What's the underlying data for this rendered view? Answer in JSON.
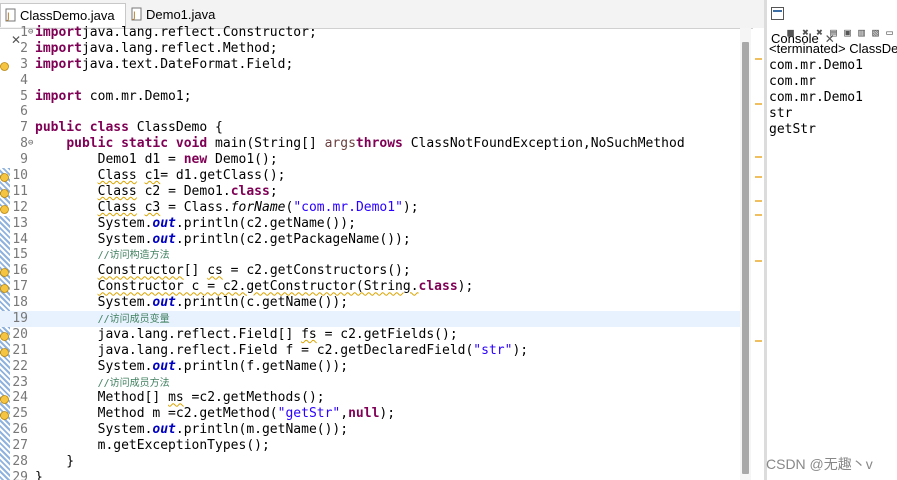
{
  "tabs": [
    {
      "label": "ClassDemo.java",
      "close": "✕",
      "active": true,
      "icon": "java-file-icon"
    },
    {
      "label": "Demo1.java",
      "active": false,
      "icon": "java-file-icon"
    }
  ],
  "code_lines": [
    {
      "n": "1",
      "fold": "⊖",
      "tokens": [
        [
          "kw",
          "import"
        ],
        [
          "",
          "java.lang.reflect.Constructor;"
        ]
      ]
    },
    {
      "n": "2",
      "tokens": [
        [
          "kw",
          "import"
        ],
        [
          "",
          "java.lang.reflect.Method;"
        ]
      ]
    },
    {
      "n": "3",
      "warn": true,
      "tokens": [
        [
          "kw",
          "import"
        ],
        [
          "",
          "java.text.DateFormat.Field;"
        ]
      ]
    },
    {
      "n": "4",
      "tokens": []
    },
    {
      "n": "5",
      "tokens": [
        [
          "kw",
          "import"
        ],
        [
          "",
          " com.mr.Demo1;"
        ]
      ]
    },
    {
      "n": "6",
      "tokens": []
    },
    {
      "n": "7",
      "tokens": [
        [
          "kw",
          "public class"
        ],
        [
          "",
          " ClassDemo {"
        ]
      ]
    },
    {
      "n": "8",
      "fold": "⊖",
      "tokens": [
        [
          "",
          "    "
        ],
        [
          "kw",
          "public static void"
        ],
        [
          "",
          " main(String[] "
        ],
        [
          "var",
          "args"
        ],
        [
          ") "
        ],
        [
          "kw",
          "throws"
        ],
        [
          "",
          " ClassNotFoundException,NoSuchMethod"
        ]
      ]
    },
    {
      "n": "9",
      "tokens": [
        [
          "",
          "        Demo1 d1 = "
        ],
        [
          "kw",
          "new"
        ],
        [
          "",
          " Demo1();"
        ]
      ]
    },
    {
      "n": "10",
      "warn": true,
      "tokens": [
        [
          "",
          "        "
        ],
        [
          "wv",
          "Class"
        ],
        [
          "",
          " "
        ],
        [
          "wv",
          "c1"
        ],
        [
          "",
          "= d1.getClass();"
        ]
      ]
    },
    {
      "n": "11",
      "warn": true,
      "tokens": [
        [
          "",
          "        "
        ],
        [
          "wv",
          "Class"
        ],
        [
          "",
          " c2 = Demo1."
        ],
        [
          "kw",
          "class"
        ],
        [
          "",
          ";"
        ]
      ]
    },
    {
      "n": "12",
      "warn": true,
      "tokens": [
        [
          "",
          "        "
        ],
        [
          "wv",
          "Class"
        ],
        [
          "",
          " "
        ],
        [
          "wv",
          "c3"
        ],
        [
          "",
          " = Class."
        ],
        [
          "ital",
          "forName"
        ],
        [
          "",
          "("
        ],
        [
          "str",
          "\"com.mr.Demo1\""
        ],
        [
          "",
          ");"
        ]
      ]
    },
    {
      "n": "13",
      "tokens": [
        [
          "",
          "        System."
        ],
        [
          "st",
          "out"
        ],
        [
          "",
          ".println(c2.getName());"
        ]
      ]
    },
    {
      "n": "14",
      "tokens": [
        [
          "",
          "        System."
        ],
        [
          "st",
          "out"
        ],
        [
          "",
          ".println(c2.getPackageName());"
        ]
      ]
    },
    {
      "n": "15",
      "tokens": [
        [
          "",
          "        "
        ],
        [
          "cm",
          "//访问构造方法"
        ]
      ]
    },
    {
      "n": "16",
      "warn": true,
      "tokens": [
        [
          "",
          "        "
        ],
        [
          "wv",
          "Constructor"
        ],
        [
          "",
          "[] "
        ],
        [
          "wv",
          "cs"
        ],
        [
          "",
          " = c2.getConstructors();"
        ]
      ]
    },
    {
      "n": "17",
      "warn": true,
      "tokens": [
        [
          "",
          "        "
        ],
        [
          "wv",
          "Constructor c = c2.getConstructor(String."
        ],
        [
          "kw",
          "class"
        ],
        [
          "",
          ");"
        ]
      ]
    },
    {
      "n": "18",
      "tokens": [
        [
          "",
          "        System."
        ],
        [
          "st",
          "out"
        ],
        [
          "",
          ".println(c.getName());"
        ]
      ]
    },
    {
      "n": "19",
      "hl": true,
      "tokens": [
        [
          "",
          "        "
        ],
        [
          "cm",
          "//访问成员变量"
        ]
      ]
    },
    {
      "n": "20",
      "warn": true,
      "tokens": [
        [
          "",
          "        java.lang.reflect.Field[] "
        ],
        [
          "wv",
          "fs"
        ],
        [
          "",
          " = c2.getFields();"
        ]
      ]
    },
    {
      "n": "21",
      "warn": true,
      "tokens": [
        [
          "",
          "        java.lang.reflect.Field f = c2.getDeclaredField("
        ],
        [
          "str",
          "\"str\""
        ],
        [
          "",
          ");"
        ]
      ]
    },
    {
      "n": "22",
      "tokens": [
        [
          "",
          "        System."
        ],
        [
          "st",
          "out"
        ],
        [
          "",
          ".println(f.getName());"
        ]
      ]
    },
    {
      "n": "23",
      "tokens": [
        [
          "",
          "        "
        ],
        [
          "cm",
          "//访问成员方法"
        ]
      ]
    },
    {
      "n": "24",
      "warn": true,
      "tokens": [
        [
          "",
          "        Method[] "
        ],
        [
          "wv",
          "ms"
        ],
        [
          "",
          " =c2.getMethods();"
        ]
      ]
    },
    {
      "n": "25",
      "warn": true,
      "tokens": [
        [
          "",
          "        Method m =c2.getMethod("
        ],
        [
          "str",
          "\"getStr\""
        ],
        [
          "",
          ","
        ],
        [
          "kw",
          "null"
        ],
        [
          "",
          ");"
        ]
      ]
    },
    {
      "n": "26",
      "tokens": [
        [
          "",
          "        System."
        ],
        [
          "st",
          "out"
        ],
        [
          "",
          ".println(m.getName());"
        ]
      ]
    },
    {
      "n": "27",
      "tokens": [
        [
          "",
          "        m.getExceptionTypes();"
        ]
      ]
    },
    {
      "n": "28",
      "tokens": [
        [
          "",
          "    }"
        ]
      ]
    },
    {
      "n": "29",
      "tokens": [
        [
          "",
          "}"
        ]
      ]
    }
  ],
  "console": {
    "tab_label": "Console",
    "close": "✕",
    "terminated": "<terminated> ClassDe",
    "output": [
      "com.mr.Demo1",
      "com.mr",
      "com.mr.Demo1",
      "str",
      "getStr"
    ]
  },
  "watermark": "CSDN @无趣丶v",
  "colors": {
    "keyword": "#7f0055",
    "string": "#2a00ff",
    "comment": "#3f7f5f",
    "highlight": "#e8f2fe"
  }
}
